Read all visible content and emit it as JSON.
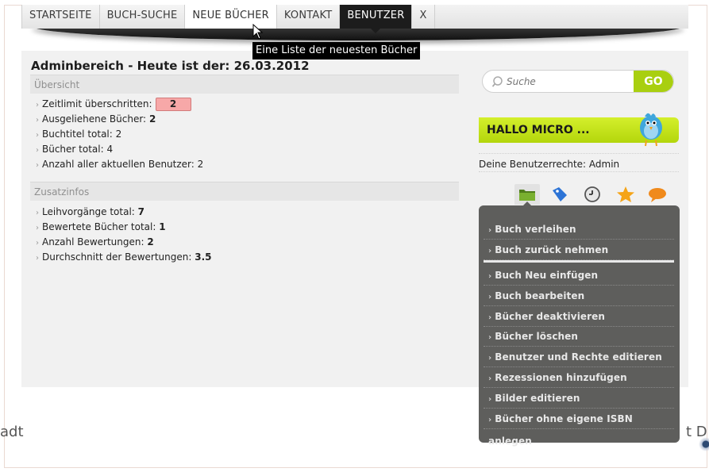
{
  "nav": {
    "items": [
      {
        "label": "STARTSEITE"
      },
      {
        "label": "BUCH-SUCHE"
      },
      {
        "label": "NEUE BÜCHER"
      },
      {
        "label": "KONTAKT"
      },
      {
        "label": "BENUTZER"
      },
      {
        "label": "X"
      }
    ],
    "active_index": 4,
    "hover_index": 2
  },
  "tooltip": "Eine Liste der neuesten Bücher",
  "main": {
    "title": "Adminbereich - Heute ist der: 26.03.2012",
    "overview": {
      "heading": "Übersicht",
      "stats": [
        {
          "label": "Zeitlimit überschritten:",
          "value": "2"
        },
        {
          "label": "Ausgeliehene Bücher:",
          "value": "2"
        },
        {
          "label": "Buchtitel total:",
          "value": "2"
        },
        {
          "label": "Bücher total:",
          "value": "4"
        },
        {
          "label": "Anzahl aller aktuellen Benutzer:",
          "value": "2"
        }
      ]
    },
    "extra": {
      "heading": "Zusatzinfos",
      "stats": [
        {
          "label": "Leihvorgänge total:",
          "value": "7"
        },
        {
          "label": "Bewertete Bücher total:",
          "value": "1"
        },
        {
          "label": "Anzahl Bewertungen:",
          "value": "2"
        },
        {
          "label": "Durchschnitt der Bewertungen:",
          "value": "3.5"
        }
      ]
    }
  },
  "sidebar": {
    "search_placeholder": "Suche",
    "search_button": "GO",
    "greeting": "HALLO MICRO ...",
    "rights_label": "Deine Benutzerrechte:",
    "rights_value": "Admin",
    "icon_tabs": [
      "folder-icon",
      "tag-icon",
      "clock-icon",
      "star-icon",
      "speech-bubble-icon"
    ],
    "menu_group1": [
      "Buch verleihen",
      "Buch zurück nehmen"
    ],
    "menu_group2": [
      "Buch Neu einfügen",
      "Buch bearbeiten",
      "Bücher deaktivieren",
      "Bücher löschen",
      "Benutzer und Rechte editieren",
      "Rezessionen hinzufügen",
      "Bilder editieren",
      "Bücher ohne eigene ISBN anlegen"
    ]
  },
  "background_fragments": {
    "left": "adt",
    "right": "t D"
  },
  "colors": {
    "accent_green": "#a9cf10",
    "nav_active": "#1c1c1c",
    "menu_bg": "#5e5e5c",
    "badge_red": "#f7a8a8"
  }
}
